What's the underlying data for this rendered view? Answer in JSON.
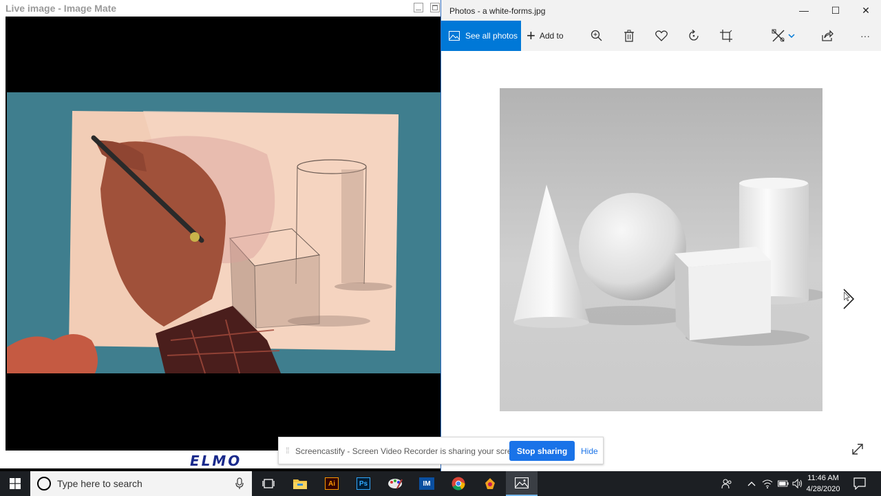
{
  "image_mate": {
    "title": "Live image - Image Mate",
    "brand": "ELMO"
  },
  "photos": {
    "title": "Photos - a white-forms.jpg",
    "toolbar": {
      "see_all_label": "See all photos",
      "add_to_label": "Add to",
      "more_label": "···"
    },
    "window_controls": {
      "minimize": "—",
      "maximize": "☐",
      "close": "✕"
    }
  },
  "screencastify": {
    "message": "Screencastify - Screen Video Recorder is sharing your screen.",
    "stop_label": "Stop sharing",
    "hide_label": "Hide"
  },
  "taskbar": {
    "search_placeholder": "Type here to search",
    "apps": [
      {
        "name": "task-view",
        "label": ""
      },
      {
        "name": "file-explorer",
        "label": ""
      },
      {
        "name": "illustrator",
        "label": "Ai"
      },
      {
        "name": "photoshop",
        "label": "Ps"
      },
      {
        "name": "paint",
        "label": ""
      },
      {
        "name": "image-mate",
        "label": "IM"
      },
      {
        "name": "chrome",
        "label": ""
      },
      {
        "name": "app-8",
        "label": ""
      },
      {
        "name": "photos",
        "label": ""
      }
    ],
    "clock": {
      "time": "11:46 AM",
      "date": "4/28/2020"
    }
  },
  "colors": {
    "accent": "#0078d7",
    "screencastify_blue": "#1a73e8",
    "taskbar": "#1c1f23",
    "elmo_blue": "#1a2a8c"
  }
}
